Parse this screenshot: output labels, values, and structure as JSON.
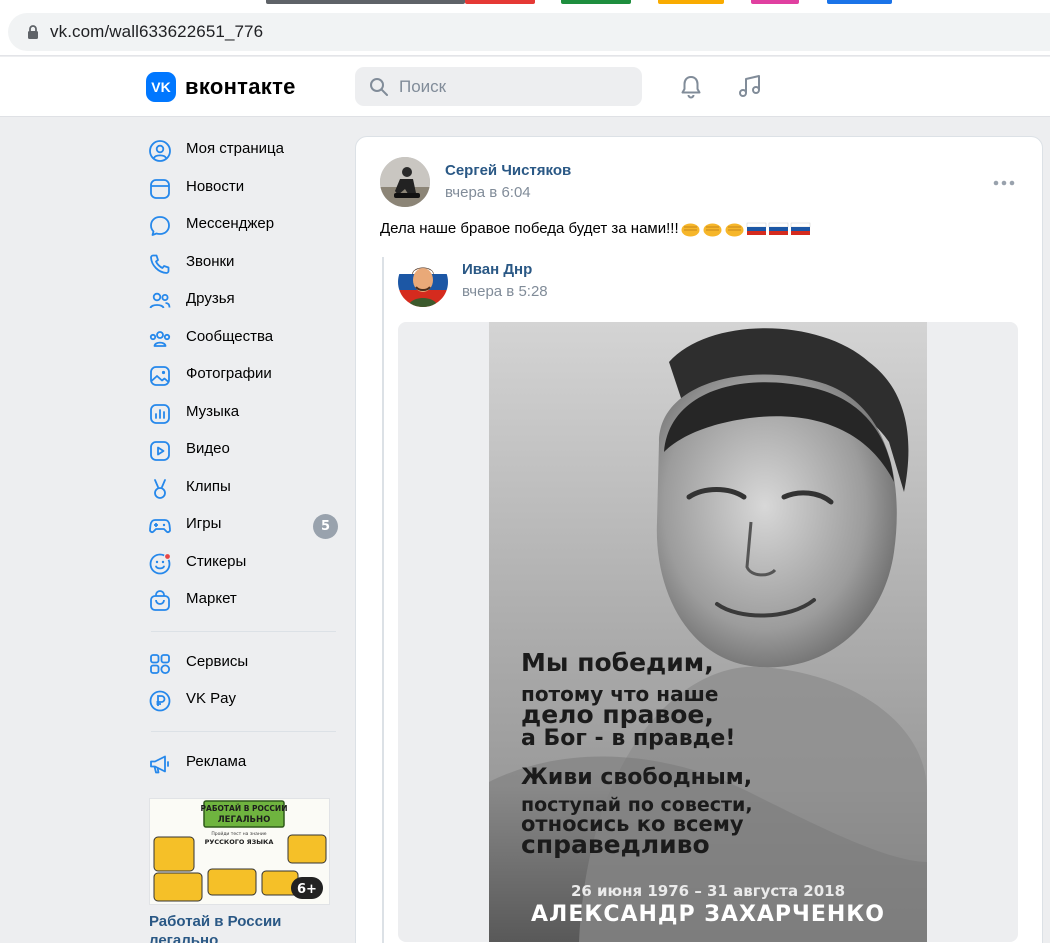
{
  "browser": {
    "url": "vk.com/wall633622651_776",
    "tab_colors": [
      "#5f6368",
      "#e53935",
      "#1e8e3e",
      "#f9ab00",
      "#e040a0",
      "#1a73e8"
    ]
  },
  "header": {
    "logo_mark": "VK",
    "logo_text": "вконтакте",
    "search_placeholder": "Поиск",
    "icons": [
      "bell-icon",
      "music-icon"
    ]
  },
  "sidebar": {
    "items": [
      {
        "label": "Моя страница",
        "icon": "user-circle-icon"
      },
      {
        "label": "Новости",
        "icon": "newsfeed-icon"
      },
      {
        "label": "Мессенджер",
        "icon": "message-icon"
      },
      {
        "label": "Звонки",
        "icon": "phone-icon"
      },
      {
        "label": "Друзья",
        "icon": "friends-icon"
      },
      {
        "label": "Сообщества",
        "icon": "communities-icon"
      },
      {
        "label": "Фотографии",
        "icon": "photo-icon"
      },
      {
        "label": "Музыка",
        "icon": "music-chart-icon"
      },
      {
        "label": "Видео",
        "icon": "video-icon"
      },
      {
        "label": "Клипы",
        "icon": "clips-icon"
      },
      {
        "label": "Игры",
        "icon": "gamepad-icon",
        "badge": "5"
      },
      {
        "label": "Стикеры",
        "icon": "smile-icon"
      },
      {
        "label": "Маркет",
        "icon": "bag-icon"
      }
    ],
    "secondary": [
      {
        "label": "Сервисы",
        "icon": "services-icon"
      },
      {
        "label": "VK Pay",
        "icon": "vkpay-icon"
      }
    ],
    "tertiary": [
      {
        "label": "Реклама",
        "icon": "megaphone-icon"
      }
    ],
    "ad": {
      "title": "Работай в России легально",
      "banner": "РАБОТАЙ В РОССИИ ЛЕГАЛЬНО",
      "subtitle": "Пройди тест на знание",
      "subtitle2": "РУССКОГО ЯЗЫКА",
      "age": "6+"
    }
  },
  "post": {
    "author": "Сергей Чистяков",
    "time": "вчера в 6:04",
    "text": "Дела наше бравое победа будет за нами!!!",
    "emojis": [
      "fist-emoji",
      "fist-emoji",
      "fist-emoji",
      "russia-flag-emoji",
      "russia-flag-emoji",
      "russia-flag-emoji"
    ],
    "repost": {
      "author": "Иван Днр",
      "time": "вчера в 5:28",
      "image": {
        "lines": [
          "Мы победим,",
          "потому что наше",
          "дело правое,",
          "а Бог - в правде!",
          "Живи свободным,",
          "поступай по совести,",
          "относись ко всему",
          "справедливо"
        ],
        "dates": "26 июня 1976 – 31 августа 2018",
        "name": "АЛЕКСАНДР ЗАХАРЧЕНКО"
      }
    }
  }
}
